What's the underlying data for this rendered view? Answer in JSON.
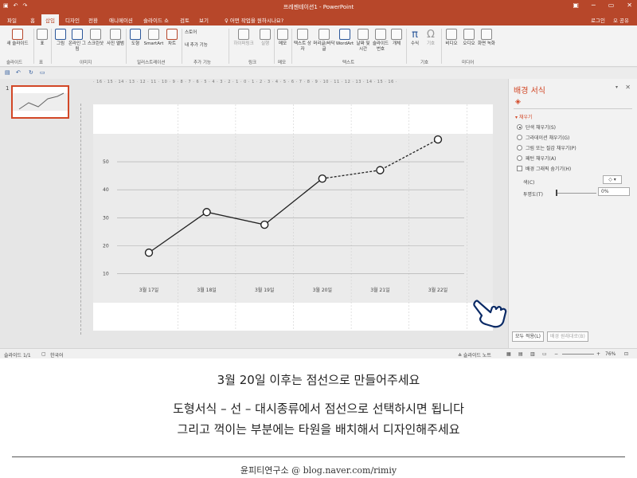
{
  "titlebar": {
    "title": "프레젠테이션1 - PowerPoint",
    "win_min": "─",
    "win_restore": "▭",
    "win_close": "✕",
    "ribbon_toggle": "▣"
  },
  "tabs": {
    "items": [
      "파일",
      "홈",
      "삽입",
      "디자인",
      "전환",
      "애니메이션",
      "슬라이드 쇼",
      "검토",
      "보기"
    ],
    "active": "삽입",
    "tell_me": "♀ 어떤 작업을 원하시나요?",
    "sign_in": "로그인",
    "share": "오 공유"
  },
  "ribbon": {
    "new_slide": "새 슬라이드",
    "table": "표",
    "pictures": "그림",
    "online_pictures": "온라인 그림",
    "screenshot": "스크린샷",
    "photo_album": "사진 앨범",
    "shapes": "도형",
    "smartart": "SmartArt",
    "chart": "차트",
    "store": "스토어",
    "my_addins": "내 추가 기능",
    "hyperlink": "하이퍼링크",
    "action": "실행",
    "comment": "메모",
    "textbox": "텍스트 상자",
    "header_footer": "머리글/바닥글",
    "wordart": "WordArt",
    "date_time": "날짜 및 시간",
    "slide_number": "슬라이드 번호",
    "object": "개체",
    "equation": "수식",
    "symbol": "기호",
    "video": "비디오",
    "audio": "오디오",
    "screen_recording": "화면 녹화",
    "groups": {
      "slides": "슬라이드",
      "tables": "표",
      "images": "이미지",
      "illustrations": "일러스트레이션",
      "addins": "추가 기능",
      "links": "링크",
      "comments": "메모",
      "text": "텍스트",
      "symbols": "기호",
      "media": "미디어"
    }
  },
  "slides_pane": {
    "slide_number": "1"
  },
  "ruler": {
    "text": "· 16 · 15 · 14 · 13 · 12 · 11 · 10 · 9 · 8 · 7 · 6 · 5 · 4 · 3 · 2 · 1 · 0 · 1 · 2 · 3 · 4 · 5 · 6 · 7 · 8 · 9 · 10 · 11 · 12 · 13 · 14 · 15 · 16 ·"
  },
  "chart_data": {
    "type": "line",
    "categories": [
      "3월 17일",
      "3월 18일",
      "3월 19일",
      "3월 20일",
      "3월 21일",
      "3월 22일"
    ],
    "values": [
      17.5,
      32,
      27.5,
      44,
      47,
      58
    ],
    "dashed_from_index": 3,
    "marker": "hollow-circle",
    "yticks": [
      10,
      20,
      30,
      40,
      50
    ],
    "ylim": [
      5,
      60
    ],
    "grid": true,
    "line_color": "#222222"
  },
  "format_pane": {
    "title": "배경 서식",
    "fill_section": "▾ 채우기",
    "options": [
      {
        "label": "단색 채우기(S)",
        "selected": true
      },
      {
        "label": "그라데이션 채우기(G)",
        "selected": false
      },
      {
        "label": "그림 또는 질감 채우기(P)",
        "selected": false
      },
      {
        "label": "패턴 채우기(A)",
        "selected": false
      }
    ],
    "hide_bg": "배경 그래픽 숨기기(H)",
    "color_label": "색(C)",
    "color_btn": "◇ ▾",
    "transparency_label": "투명도(T)",
    "transparency_value": "0%",
    "apply_all": "모두 적용(L)",
    "reset_bg": "배경 원래대로(B)"
  },
  "statusbar": {
    "slide_info": "슬라이드 1/1",
    "language": "한국어",
    "notes": "≙ 슬라이드 노트",
    "zoom": "76%"
  },
  "caption": {
    "line1": "3월 20일 이후는 점선으로 만들어주세요",
    "line2": "도형서식 – 선 – 대시종류에서 점선으로 선택하시면 됩니다",
    "line3": "그리고 꺽이는 부분에는 타원을 배치해서 디자인해주세요",
    "footer": "윤피티연구소 @ blog.naver.com/rimiy"
  },
  "colors": {
    "brand": "#b7472a",
    "accent": "#d24726"
  }
}
